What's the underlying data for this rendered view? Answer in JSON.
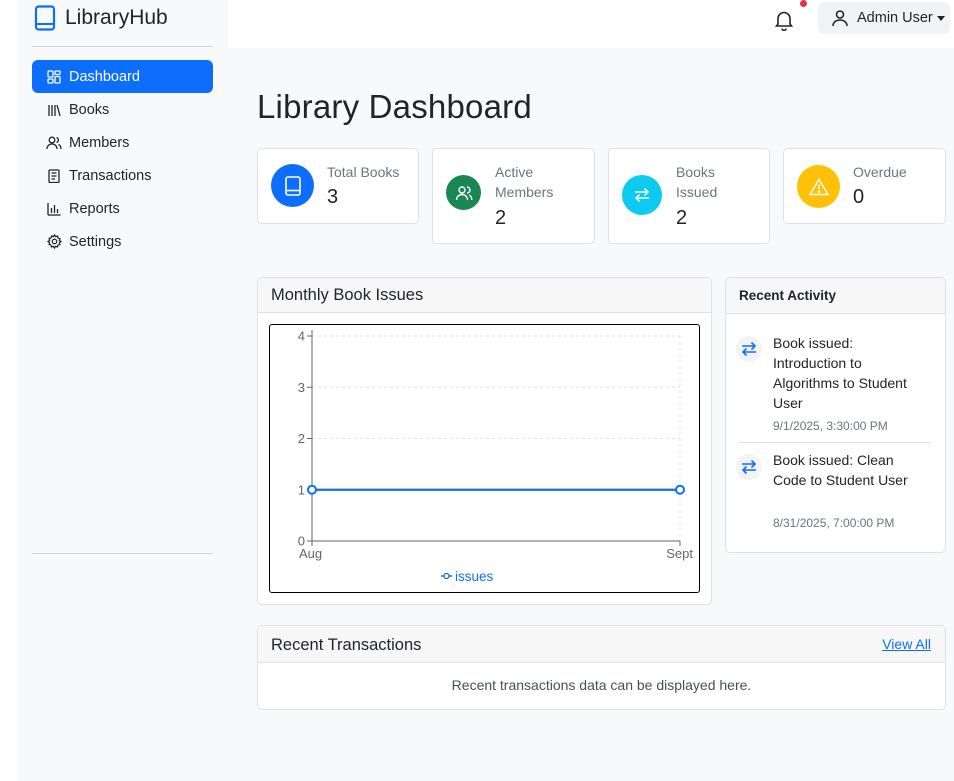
{
  "brand": {
    "name": "LibraryHub",
    "icon": "book-icon",
    "color": "#0d6efd"
  },
  "sidebar": {
    "items": [
      {
        "label": "Dashboard",
        "icon": "dashboard-grid-icon",
        "active": true
      },
      {
        "label": "Books",
        "icon": "books-icon",
        "active": false
      },
      {
        "label": "Members",
        "icon": "people-icon",
        "active": false
      },
      {
        "label": "Transactions",
        "icon": "receipt-icon",
        "active": false
      },
      {
        "label": "Reports",
        "icon": "bar-chart-icon",
        "active": false
      },
      {
        "label": "Settings",
        "icon": "gear-icon",
        "active": false
      }
    ]
  },
  "topbar": {
    "bell_icon": "bell-icon",
    "notification_dot": true,
    "user_name": "Admin User",
    "user_icon": "person-icon"
  },
  "page": {
    "title": "Library Dashboard"
  },
  "stats": [
    {
      "label": "Total Books",
      "value": "3",
      "icon": "book-icon",
      "color": "#0d6efd"
    },
    {
      "label": "Active Members",
      "value": "2",
      "icon": "people-icon",
      "color": "#198754"
    },
    {
      "label": "Books Issued",
      "value": "2",
      "icon": "arrows-exchange-icon",
      "color": "#0dcaf0"
    },
    {
      "label": "Overdue",
      "value": "0",
      "icon": "warning-triangle-icon",
      "color": "#ffc107"
    }
  ],
  "chart_panel": {
    "title": "Monthly Book Issues"
  },
  "chart_data": {
    "type": "line",
    "categories": [
      "Aug",
      "Sept"
    ],
    "series": [
      {
        "name": "issues",
        "values": [
          1,
          1
        ],
        "color": "#0d6efd"
      }
    ],
    "yticks": [
      "0",
      "1",
      "2",
      "3",
      "4"
    ],
    "ylim": [
      0,
      4
    ],
    "grid": true,
    "legend": "bottom"
  },
  "activity": {
    "title": "Recent Activity",
    "items": [
      {
        "text": "Book issued: Introduction to Algorithms to Student User",
        "time": "9/1/2025, 3:30:00 PM",
        "icon": "arrows-exchange-icon"
      },
      {
        "text": "Book issued: Clean Code to Student User",
        "time": "8/31/2025, 7:00:00 PM",
        "icon": "arrows-exchange-icon"
      }
    ]
  },
  "transactions": {
    "title": "Recent Transactions",
    "view_all": "View All",
    "empty_text": "Recent transactions data can be displayed here."
  }
}
